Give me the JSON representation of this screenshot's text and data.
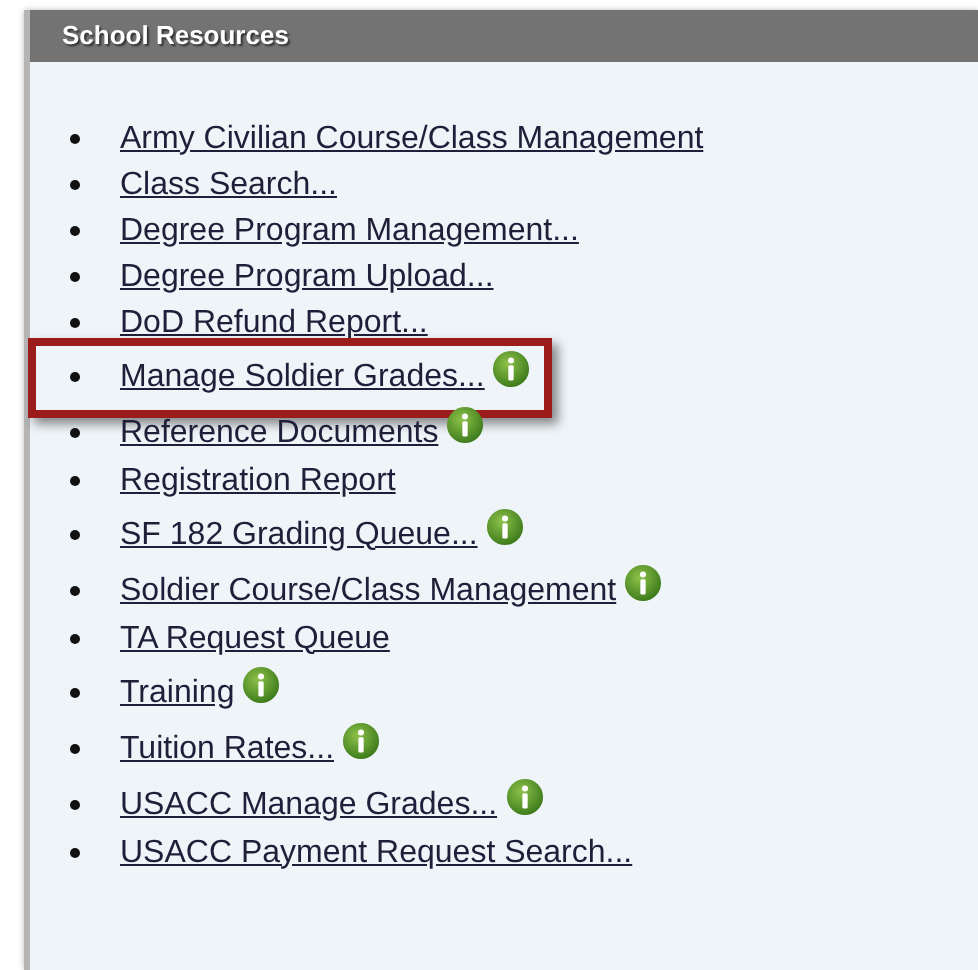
{
  "panel": {
    "title": "School Resources"
  },
  "items": [
    {
      "label": "Army Civilian Course/Class Management",
      "info": false,
      "highlighted": false
    },
    {
      "label": "Class Search...",
      "info": false,
      "highlighted": false
    },
    {
      "label": "Degree Program Management...",
      "info": false,
      "highlighted": false
    },
    {
      "label": "Degree Program Upload...",
      "info": false,
      "highlighted": false
    },
    {
      "label": "DoD Refund Report...",
      "info": false,
      "highlighted": false
    },
    {
      "label": "Manage Soldier Grades...",
      "info": true,
      "highlighted": true
    },
    {
      "label": "Reference Documents",
      "info": true,
      "highlighted": false
    },
    {
      "label": "Registration Report",
      "info": false,
      "highlighted": false
    },
    {
      "label": "SF 182 Grading Queue...",
      "info": true,
      "highlighted": false
    },
    {
      "label": "Soldier Course/Class Management",
      "info": true,
      "highlighted": false
    },
    {
      "label": "TA Request Queue",
      "info": false,
      "highlighted": false
    },
    {
      "label": "Training",
      "info": true,
      "highlighted": false
    },
    {
      "label": "Tuition Rates...",
      "info": true,
      "highlighted": false
    },
    {
      "label": "USACC Manage Grades...",
      "info": true,
      "highlighted": false
    },
    {
      "label": "USACC Payment Request Search...",
      "info": false,
      "highlighted": false
    }
  ]
}
